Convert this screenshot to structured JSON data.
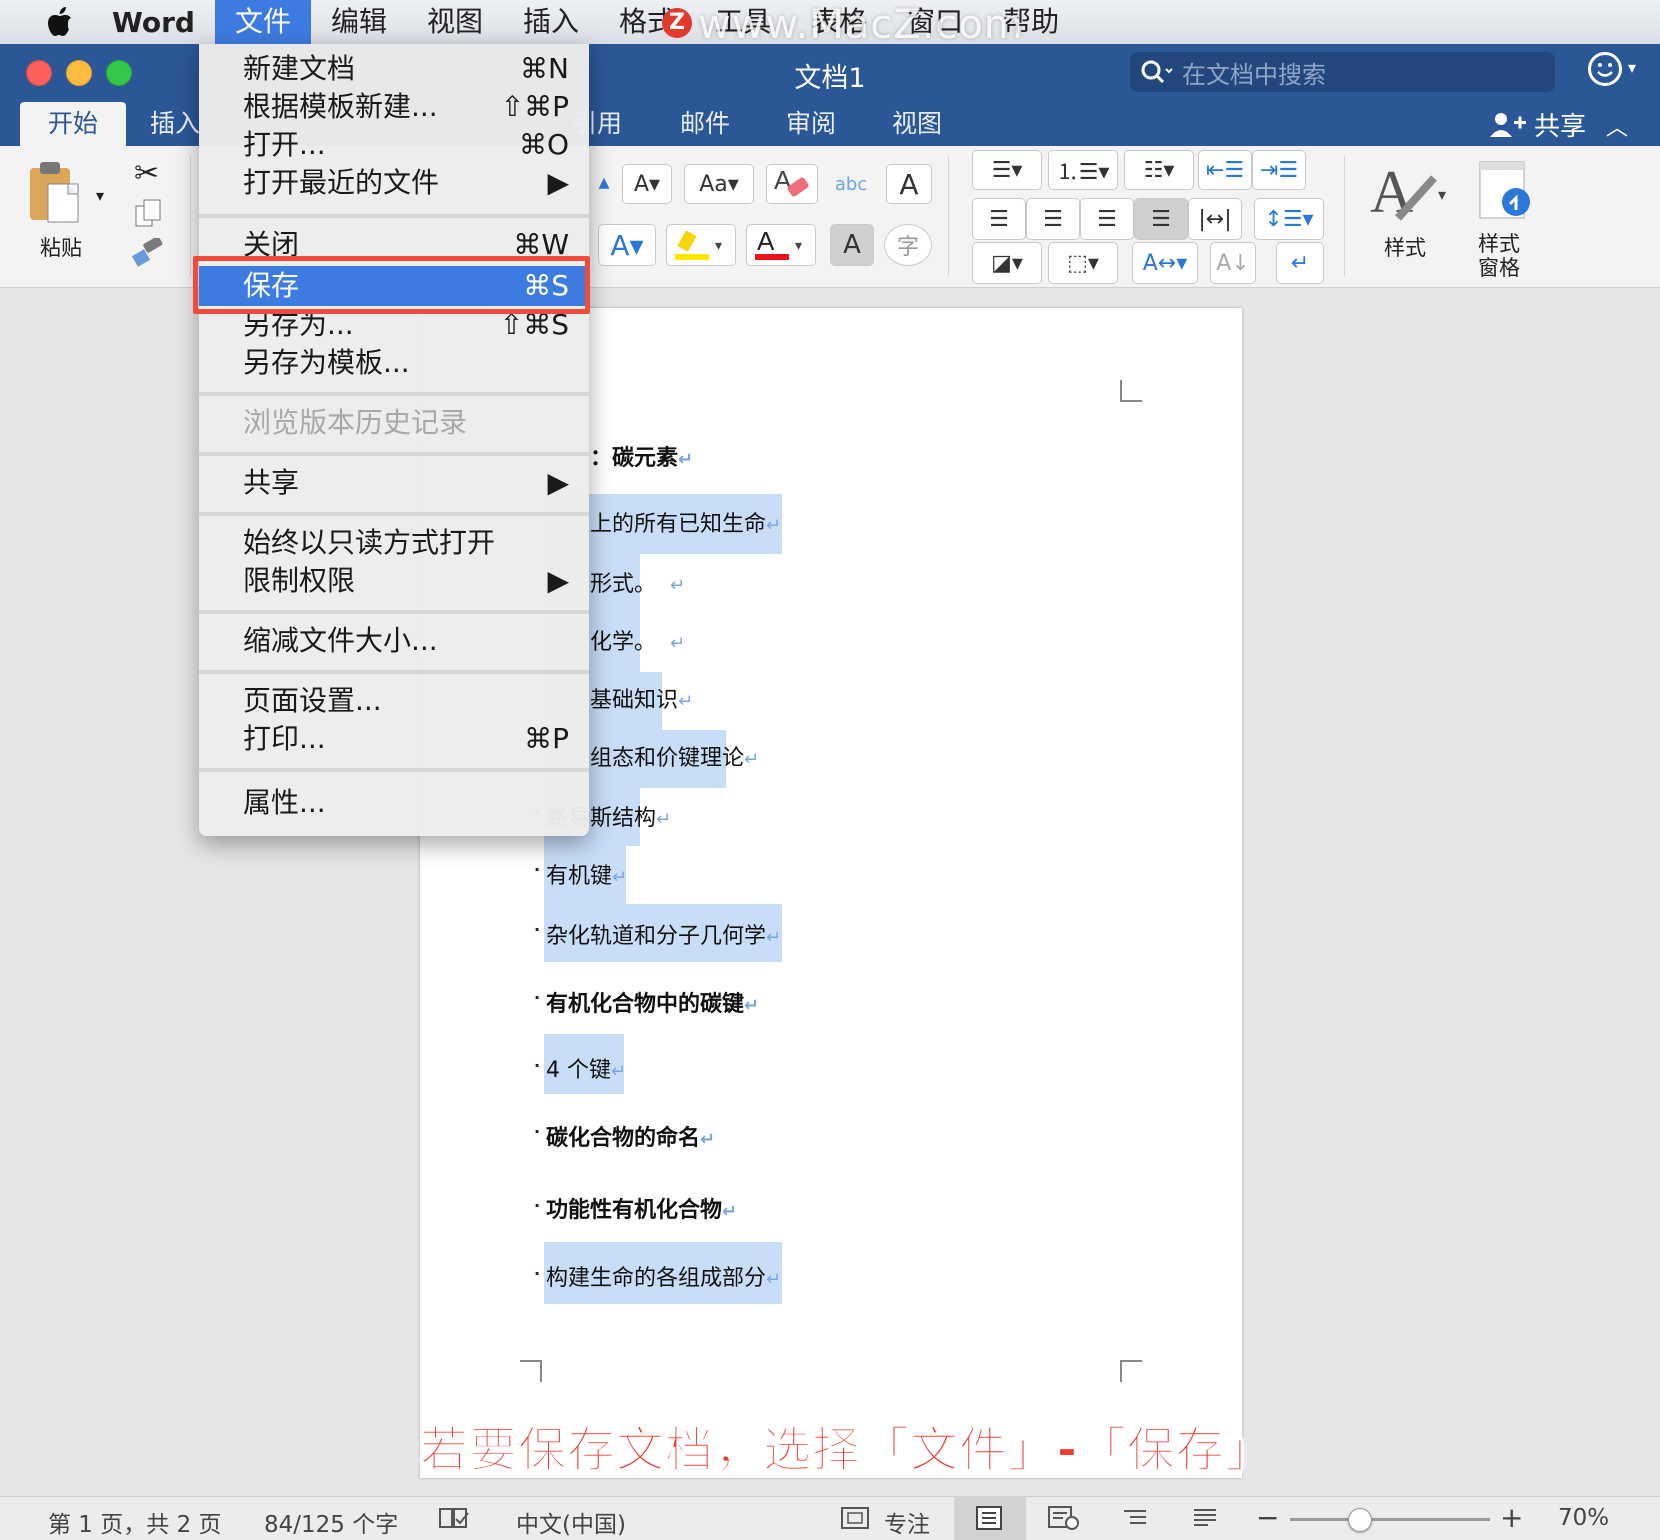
{
  "menubar": {
    "app_name": "Word",
    "items": [
      "文件",
      "编辑",
      "视图",
      "插入",
      "格式",
      "工具",
      "表格",
      "窗口",
      "帮助"
    ],
    "active_item": "文件",
    "watermark": "www.MacZ.com",
    "watermark_logo": "Z"
  },
  "window": {
    "title": "文档1",
    "search_placeholder": "在文档中搜索"
  },
  "ribbon_tabs": {
    "items": [
      "开始",
      "插入",
      "引用",
      "邮件",
      "审阅",
      "视图"
    ],
    "active": "开始",
    "share_label": "共享"
  },
  "ribbon": {
    "paste_label": "粘贴",
    "styles_label": "样式",
    "styles_pane_label_line1": "样式",
    "styles_pane_label_line2": "窗格"
  },
  "file_menu": {
    "items": [
      {
        "label": "新建文档",
        "shortcut": "⌘N"
      },
      {
        "label": "根据模板新建...",
        "shortcut": "⇧⌘P"
      },
      {
        "label": "打开...",
        "shortcut": "⌘O"
      },
      {
        "label": "打开最近的文件",
        "shortcut": "▶"
      },
      {
        "label": "关闭",
        "shortcut": "⌘W"
      },
      {
        "label": "保存",
        "shortcut": "⌘S"
      },
      {
        "label": "另存为...",
        "shortcut": "⇧⌘S"
      },
      {
        "label": "另存为模板...",
        "shortcut": ""
      },
      {
        "label": "浏览版本历史记录",
        "shortcut": ""
      },
      {
        "label": "共享",
        "shortcut": "▶"
      },
      {
        "label": "始终以只读方式打开",
        "shortcut": ""
      },
      {
        "label": "限制权限",
        "shortcut": "▶"
      },
      {
        "label": "缩减文件大小...",
        "shortcut": ""
      },
      {
        "label": "页面设置...",
        "shortcut": ""
      },
      {
        "label": "打印...",
        "shortcut": "⌘P"
      },
      {
        "label": "属性...",
        "shortcut": ""
      }
    ],
    "selected": "保存",
    "disabled": [
      "浏览版本历史记录"
    ]
  },
  "document": {
    "lines": [
      {
        "text": "：碳元素",
        "bold": true
      },
      {
        "text": "上的所有已知生命",
        "bold": false
      },
      {
        "text": "形式。",
        "bold": false
      },
      {
        "text": "化学。",
        "bold": false
      },
      {
        "text": "基础知识",
        "bold": false
      },
      {
        "text": "组态和价键理论",
        "bold": false
      },
      {
        "text": "路易斯结构",
        "bold": false
      },
      {
        "text": "有机键",
        "bold": false
      },
      {
        "text": "杂化轨道和分子几何学",
        "bold": false
      },
      {
        "text": "有机化合物中的碳键",
        "bold": true
      },
      {
        "text": "4 个键",
        "bold": false
      },
      {
        "text": "碳化合物的命名",
        "bold": true
      },
      {
        "text": "功能性有机化合物",
        "bold": true
      },
      {
        "text": "构建生命的各组成部分",
        "bold": false
      }
    ],
    "paragraph_mark": "↵"
  },
  "caption": "若要保存文档，选择「文件」-「保存」",
  "statusbar": {
    "page_info": "第 1 页，共 2 页",
    "word_count": "84/125 个字",
    "language": "中文(中国)",
    "focus_label": "专注",
    "zoom": "70%"
  },
  "colors": {
    "accent": "#2b5797",
    "menu_highlight": "#3d7be0",
    "annotation_red": "#ea3b2e",
    "selection": "#c8ddf7"
  }
}
